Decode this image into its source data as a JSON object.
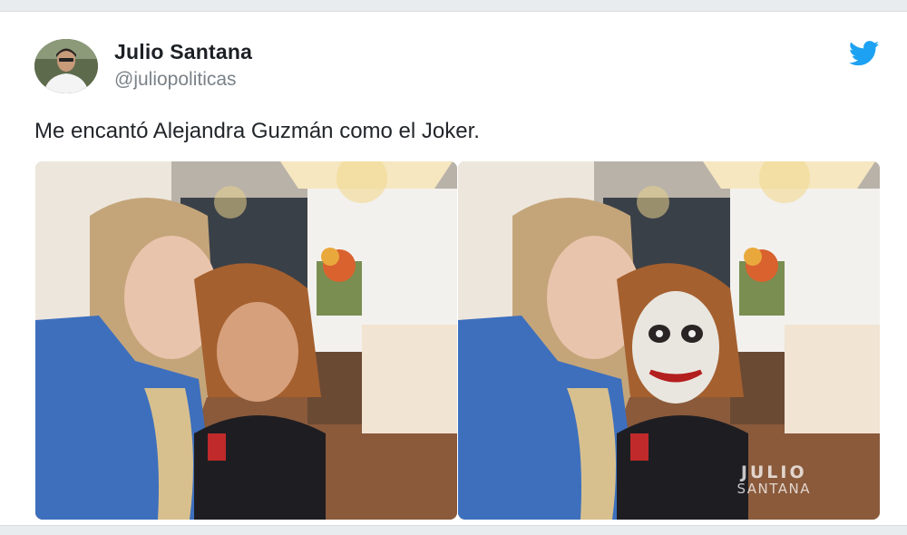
{
  "tweet": {
    "display_name": "Julio Santana",
    "handle": "@juliopoliticas",
    "text": "Me encantó Alejandra Guzmán como el Joker.",
    "avatar_icon": "user-avatar",
    "platform_icon": "twitter-bird-icon",
    "brand_color": "#1da1f2"
  },
  "media": {
    "images": [
      {
        "name": "selfie-original",
        "description_icon": "photo"
      },
      {
        "name": "selfie-joker-edit",
        "description_icon": "photo"
      }
    ],
    "watermark": {
      "line1": "JULIO",
      "line2": "SANTANA"
    }
  }
}
